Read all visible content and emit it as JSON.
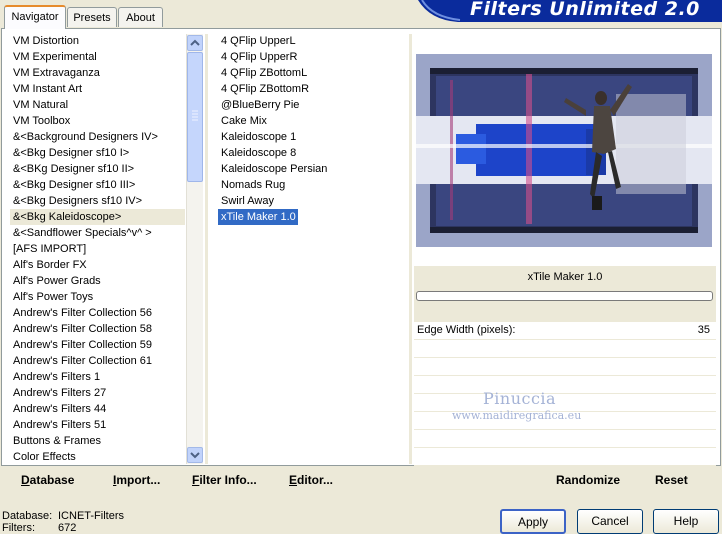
{
  "tabs": [
    "Navigator",
    "Presets",
    "About"
  ],
  "app_title": "Filters Unlimited 2.0",
  "categories": [
    "VM Distortion",
    "VM Experimental",
    "VM Extravaganza",
    "VM Instant Art",
    "VM Natural",
    "VM Toolbox",
    "&<Background Designers IV>",
    "&<Bkg Designer sf10 I>",
    "&<BKg Designer sf10 II>",
    "&<Bkg Designer sf10 III>",
    "&<Bkg Designers sf10 IV>",
    "&<Bkg Kaleidoscope>",
    "&<Sandflower Specials^v^ >",
    "[AFS IMPORT]",
    "Alf's Border FX",
    "Alf's Power Grads",
    "Alf's Power Toys",
    "Andrew's Filter Collection 56",
    "Andrew's Filter Collection 58",
    "Andrew's Filter Collection 59",
    "Andrew's Filter Collection 61",
    "Andrew's Filters 1",
    "Andrew's Filters 27",
    "Andrew's Filters 44",
    "Andrew's Filters 51",
    "Buttons & Frames",
    "Color Effects"
  ],
  "selected_category": "&<Bkg Kaleidoscope>",
  "filters": [
    "4 QFlip UpperL",
    "4 QFlip UpperR",
    "4 QFlip ZBottomL",
    "4 QFlip ZBottomR",
    "@BlueBerry Pie",
    "Cake Mix",
    "Kaleidoscope 1",
    "Kaleidoscope 8",
    "Kaleidoscope Persian",
    "Nomads Rug",
    "Swirl Away",
    "xTile Maker 1.0"
  ],
  "selected_filter": "xTile Maker 1.0",
  "preview_title": "xTile Maker 1.0",
  "parameter": {
    "label": "Edge Width (pixels):",
    "value": "35"
  },
  "watermark": {
    "line1": "Pinuccia",
    "line2": "www.maidiregrafica.eu"
  },
  "bottom_links": {
    "database": "Database",
    "import": "Import...",
    "filter_info": "Filter Info...",
    "editor": "Editor...",
    "randomize": "Randomize",
    "reset": "Reset"
  },
  "status": {
    "database_label": "Database:",
    "database_value": "ICNET-Filters",
    "filters_label": "Filters:",
    "filters_value": "672"
  },
  "buttons": {
    "apply": "Apply",
    "cancel": "Cancel",
    "help": "Help"
  },
  "colors": {
    "banner": "#0a2b9c",
    "selection": "#316ac5",
    "window": "#ece9d8"
  }
}
